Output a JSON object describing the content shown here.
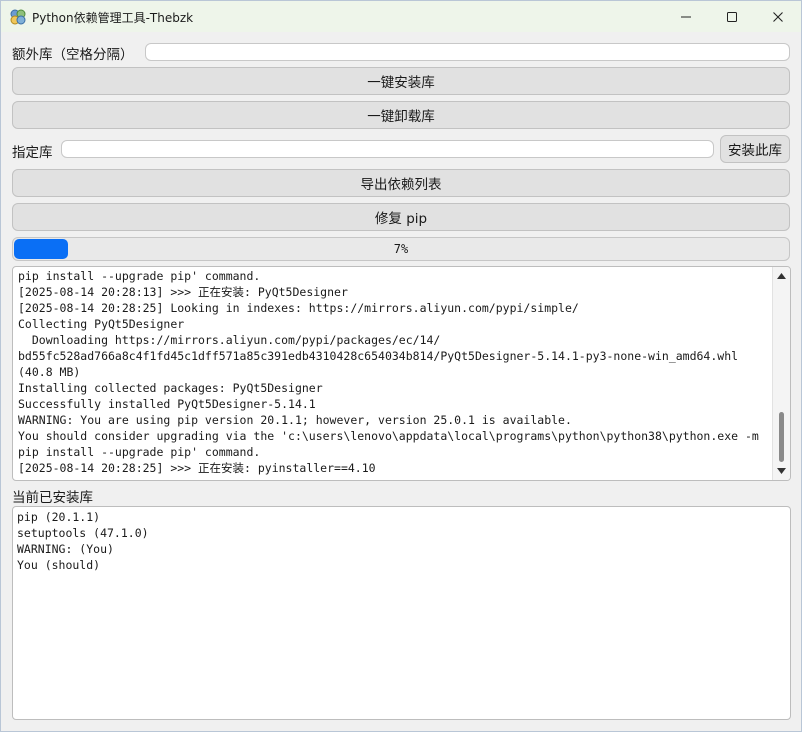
{
  "window": {
    "title": "Python依赖管理工具-Thebzk"
  },
  "extra_libs": {
    "label": "额外库（空格分隔）",
    "value": "",
    "placeholder": ""
  },
  "buttons": {
    "install_all": "一键安装库",
    "uninstall_all": "一键卸载库",
    "install_this": "安装此库",
    "export_deps": "导出依赖列表",
    "repair_pip": "修复 pip"
  },
  "specified_lib": {
    "label": "指定库",
    "value": "",
    "placeholder": ""
  },
  "progress": {
    "value": 7,
    "text": "7%"
  },
  "log": {
    "lines": [
      "pip install --upgrade pip' command.",
      "[2025-08-14 20:28:13] >>> 正在安装: PyQt5Designer",
      "[2025-08-14 20:28:25] Looking in indexes: https://mirrors.aliyun.com/pypi/simple/",
      "Collecting PyQt5Designer",
      "  Downloading https://mirrors.aliyun.com/pypi/packages/ec/14/",
      "bd55fc528ad766a8c4f1fd45c1dff571a85c391edb4310428c654034b814/PyQt5Designer-5.14.1-py3-none-win_amd64.whl",
      "(40.8 MB)",
      "Installing collected packages: PyQt5Designer",
      "Successfully installed PyQt5Designer-5.14.1",
      "WARNING: You are using pip version 20.1.1; however, version 25.0.1 is available.",
      "You should consider upgrading via the 'c:\\users\\lenovo\\appdata\\local\\programs\\python\\python38\\python.exe -m",
      "pip install --upgrade pip' command.",
      "[2025-08-14 20:28:25] >>> 正在安装: pyinstaller==4.10"
    ]
  },
  "installed": {
    "label": "当前已安装库",
    "lines": [
      "pip (20.1.1)",
      "setuptools (47.1.0)",
      "WARNING: (You)",
      "You (should)"
    ]
  },
  "colors": {
    "progress_fill": "#0a6ff5",
    "titlebar": "#eef5ea"
  }
}
